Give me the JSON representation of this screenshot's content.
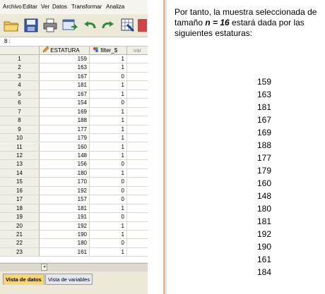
{
  "menu": [
    "Archivo",
    "Editar",
    "Ver",
    "Datos",
    "Transformar",
    "Analiza"
  ],
  "cell_ref": "8 :",
  "columns": {
    "estatura": "ESTATURA",
    "filter": "filter_$",
    "var": "var"
  },
  "rows": [
    {
      "n": "1",
      "estatura": "159",
      "filter": "1",
      "excluded": false
    },
    {
      "n": "2",
      "estatura": "163",
      "filter": "1",
      "excluded": false
    },
    {
      "n": "3",
      "estatura": "167",
      "filter": "0",
      "excluded": true
    },
    {
      "n": "4",
      "estatura": "181",
      "filter": "1",
      "excluded": false
    },
    {
      "n": "5",
      "estatura": "167",
      "filter": "1",
      "excluded": false
    },
    {
      "n": "6",
      "estatura": "154",
      "filter": "0",
      "excluded": true
    },
    {
      "n": "7",
      "estatura": "169",
      "filter": "1",
      "excluded": false
    },
    {
      "n": "8",
      "estatura": "188",
      "filter": "1",
      "excluded": false
    },
    {
      "n": "9",
      "estatura": "177",
      "filter": "1",
      "excluded": false
    },
    {
      "n": "10",
      "estatura": "179",
      "filter": "1",
      "excluded": false
    },
    {
      "n": "11",
      "estatura": "160",
      "filter": "1",
      "excluded": false
    },
    {
      "n": "12",
      "estatura": "148",
      "filter": "1",
      "excluded": false
    },
    {
      "n": "13",
      "estatura": "156",
      "filter": "0",
      "excluded": true
    },
    {
      "n": "14",
      "estatura": "180",
      "filter": "1",
      "excluded": false
    },
    {
      "n": "15",
      "estatura": "170",
      "filter": "0",
      "excluded": true
    },
    {
      "n": "16",
      "estatura": "192",
      "filter": "0",
      "excluded": true
    },
    {
      "n": "17",
      "estatura": "157",
      "filter": "0",
      "excluded": true
    },
    {
      "n": "18",
      "estatura": "181",
      "filter": "1",
      "excluded": false
    },
    {
      "n": "19",
      "estatura": "191",
      "filter": "0",
      "excluded": true
    },
    {
      "n": "20",
      "estatura": "192",
      "filter": "1",
      "excluded": false
    },
    {
      "n": "21",
      "estatura": "190",
      "filter": "1",
      "excluded": false
    },
    {
      "n": "22",
      "estatura": "180",
      "filter": "0",
      "excluded": true
    },
    {
      "n": "23",
      "estatura": "161",
      "filter": "1",
      "excluded": false
    }
  ],
  "tabs": {
    "data_view": "Vista de datos",
    "variable_view": "Vista de variables"
  },
  "text": {
    "p1": "Por tanto, la muestra seleccionada de tamaño ",
    "n_expr": "n = 16",
    "p2": " estará dada por las siguientes estaturas:"
  },
  "sample": [
    "159",
    "163",
    "181",
    "167",
    "169",
    "188",
    "177",
    "179",
    "160",
    "148",
    "180",
    "181",
    "192",
    "190",
    "161",
    "184"
  ],
  "colors": {
    "active_tab": "#f7d774",
    "divider": "#f4b184"
  }
}
